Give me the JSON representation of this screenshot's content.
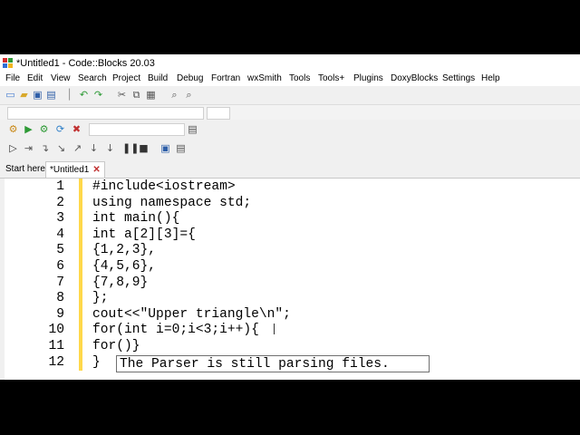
{
  "window": {
    "title": "*Untitled1 - Code::Blocks 20.03"
  },
  "menu": [
    "File",
    "Edit",
    "View",
    "Search",
    "Project",
    "Build",
    "Debug",
    "Fortran",
    "wxSmith",
    "Tools",
    "Tools+",
    "Plugins",
    "DoxyBlocks",
    "Settings",
    "Help"
  ],
  "tabs": [
    {
      "label": "Start here",
      "active": false
    },
    {
      "label": "*Untitled1",
      "active": true,
      "close": "✕"
    }
  ],
  "editor": {
    "lines": [
      {
        "num": "1",
        "text": "#include<iostream>"
      },
      {
        "num": "2",
        "text": "using namespace std;"
      },
      {
        "num": "3",
        "text": "int main(){"
      },
      {
        "num": "4",
        "text": "int a[2][3]={"
      },
      {
        "num": "5",
        "text": "{1,2,3},"
      },
      {
        "num": "6",
        "text": "{4,5,6},"
      },
      {
        "num": "7",
        "text": "{7,8,9}"
      },
      {
        "num": "8",
        "text": "};"
      },
      {
        "num": "9",
        "text": "cout<<\"Upper triangle\\n\";"
      },
      {
        "num": "10",
        "text": "for(int i=0;i<3;i++){"
      },
      {
        "num": "11",
        "text": "for()}"
      },
      {
        "num": "12",
        "text": "}"
      }
    ]
  },
  "tooltip": "The Parser is still parsing files."
}
